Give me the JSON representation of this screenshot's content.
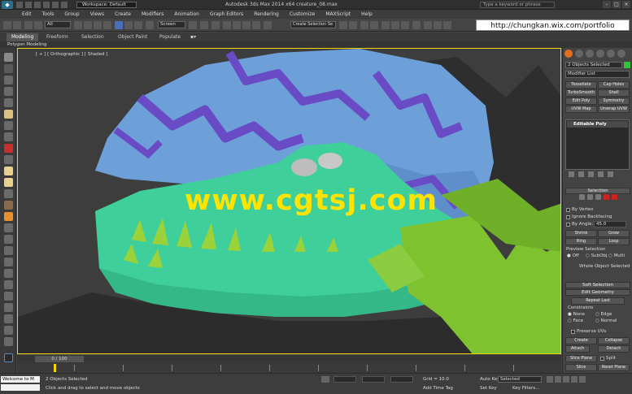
{
  "titlebar": {
    "workspace": "Workspace: Default",
    "title": "Autodesk 3ds Max  2014 x64      creature_08.max",
    "search_placeholder": "Type a keyword or phrase"
  },
  "menu": [
    "Edit",
    "Tools",
    "Group",
    "Views",
    "Create",
    "Modifiers",
    "Animation",
    "Graph Editors",
    "Rendering",
    "Customize",
    "MAXScript",
    "Help"
  ],
  "toolbar": {
    "selection_filter": "All",
    "ref_coord": "Screen",
    "selection_set": "Create Selection Se"
  },
  "overlay": {
    "url": "http://chungkan.wix.com/portfolio",
    "watermark": "www.cgtsj.com"
  },
  "ribbon": {
    "tabs": [
      "Modeling",
      "Freeform",
      "Selection",
      "Object Paint",
      "Populate"
    ],
    "active_tab": "Modeling",
    "subpanel": "Polygon Modeling"
  },
  "viewport": {
    "label": "[ + ] [ Orthographic ] [ Shaded ]"
  },
  "command_panel": {
    "objects_selected": "2 Objects Selected",
    "object_color": "#36c233",
    "modifier_list": "Modifier List",
    "modifier_buttons": [
      "Tessellate",
      "Cap Holes",
      "TurboSmooth",
      "Shell",
      "Edit Poly",
      "Symmetry",
      "UVW Map",
      "Unwrap UVW"
    ],
    "stack_item": "Editable Poly",
    "selection_rollout": "Selection",
    "by_vertex": "By Vertex",
    "ignore_backfacing": "Ignore Backfacing",
    "by_angle": "By Angle:",
    "by_angle_value": "45.0",
    "shrink": "Shrink",
    "grow": "Grow",
    "ring": "Ring",
    "loop": "Loop",
    "preview_selection": "Preview Selection",
    "preview_off": "Off",
    "preview_subobj": "SubObj",
    "preview_multi": "Multi",
    "whole_object_selected": "Whole Object Selected",
    "soft_selection": "Soft Selection",
    "edit_geometry": "Edit Geometry",
    "repeat_last": "Repeat Last",
    "constraints": "Constraints",
    "c_none": "None",
    "c_edge": "Edge",
    "c_face": "Face",
    "c_normal": "Normal",
    "preserve_uvs": "Preserve UVs",
    "create": "Create",
    "collapse": "Collapse",
    "attach": "Attach",
    "detach": "Detach",
    "slice_plane": "Slice Plane",
    "split": "Split",
    "slice": "Slice",
    "reset_plane": "Reset Plane"
  },
  "timeline": {
    "frame": "0 / 100"
  },
  "statusbar": {
    "maxscript": "Welcome to M",
    "objects_selected": "2 Objects Selected",
    "prompt": "Click and drag to select and move objects",
    "grid": "Grid = 10.0",
    "add_time_tag": "Add Time Tag",
    "auto_key": "Auto Key",
    "auto_key_mode": "Selected",
    "set_key": "Set Key",
    "key_filters": "Key Filters..."
  }
}
